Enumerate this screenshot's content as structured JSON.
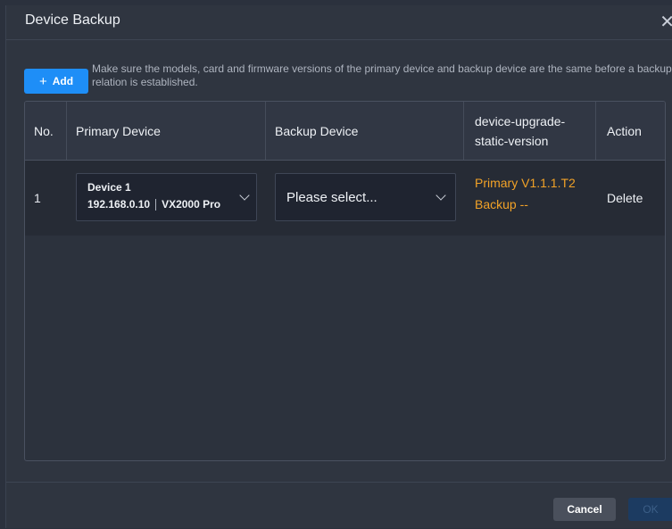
{
  "dialog": {
    "title": "Device Backup",
    "close_symbol": "✕"
  },
  "toolbar": {
    "add_icon": "+",
    "add_label": "Add",
    "notice": "Make sure the models, card and firmware versions of the primary device and backup device are the same before a backup relation is established."
  },
  "table": {
    "columns": [
      "No.",
      "Primary Device",
      "Backup Device",
      "device-upgrade-static-version",
      "Action"
    ],
    "rows": [
      {
        "no": "1",
        "primary_name": "Device 1",
        "primary_ip": "192.168.0.10",
        "primary_model": "VX2000 Pro",
        "backup_placeholder": "Please select...",
        "version_primary": "Primary V1.1.1.T2",
        "version_backup": "Backup --",
        "action": "Delete"
      }
    ]
  },
  "footer": {
    "cancel_label": "Cancel",
    "ok_label": "OK"
  },
  "colors": {
    "accent": "#1e8ef7",
    "version_text": "#f2a227",
    "background": "#2f3540"
  }
}
